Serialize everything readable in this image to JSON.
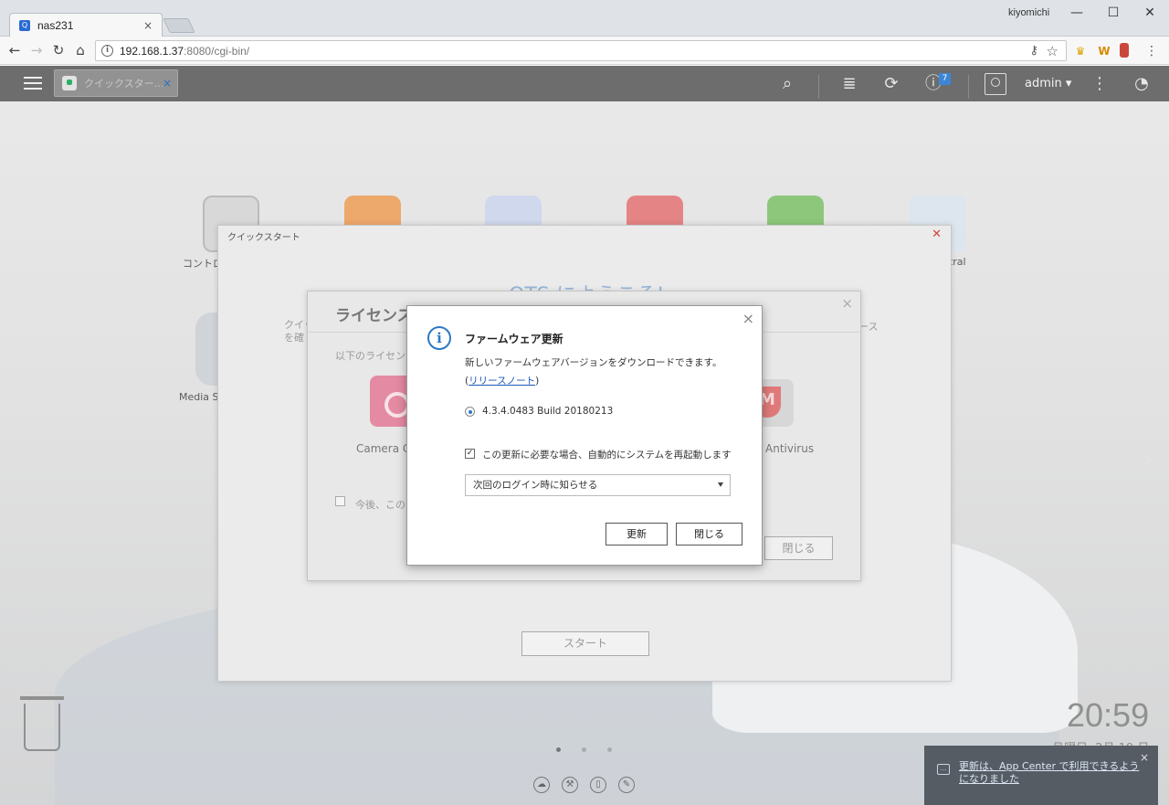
{
  "browser": {
    "tab_title": "nas231",
    "tab_close": "×",
    "window_user": "kiyomichi",
    "min": "—",
    "max": "☐",
    "close": "✕",
    "back": "←",
    "forward": "→",
    "reload": "↻",
    "home": "⌂",
    "url_host": "192.168.1.37",
    "url_rest": ":8080/cgi-bin/",
    "info_icon": "i",
    "key_icon": "⚷",
    "star_icon": "☆"
  },
  "qts_bar": {
    "app_tab_label": "クイックスター…",
    "app_tab_close": "×",
    "search": "⌕",
    "stack": "≣",
    "sync": "⟳",
    "info": "ⓘ",
    "notification_count": "7",
    "admin": "admin ▾",
    "more": "⋮",
    "dashboard": "◔"
  },
  "desktop": {
    "icon_label_1": "コントロ",
    "icon_label_2": "ntral",
    "icon_label_3": "Media St",
    "clock": "20:59",
    "date": "月曜日, 2月 19 日",
    "arrow": "›"
  },
  "quickstart": {
    "title": "クイックスタート",
    "close": "✕",
    "welcome": "QTS にようこそ!",
    "intro_line1": "クイッ",
    "intro_line2": "を確",
    "intro_right": "ペース",
    "start_button": "スタート"
  },
  "license": {
    "title": "ライセンス",
    "close": "×",
    "description": "以下のライセンス",
    "camera_label": "Camera C",
    "antivirus_label": "Antivirus",
    "checkbox_label": "今後、この",
    "close_button": "閉じる"
  },
  "firmware": {
    "info_icon": "i",
    "close": "×",
    "title": "ファームウェア更新",
    "description": "新しいファームウェアバージョンをダウンロードできます。",
    "link_open": "(",
    "link_text": "リリースノート",
    "link_close": ")",
    "version": "4.3.4.0483 Build 20180213",
    "auto_restart": "この更新に必要な場合、自動的にシステムを再起動します",
    "check_mark": "✓",
    "select_value": "次回のログイン時に知らせる",
    "update_button": "更新",
    "close_button": "閉じる"
  },
  "notification": {
    "message": "更新は、App Center で利用できるようになりました",
    "close": "×"
  },
  "colors": {
    "accent": "#2b78c5",
    "qts_bar": "#6d6d6d",
    "close_red": "#d0443e"
  }
}
